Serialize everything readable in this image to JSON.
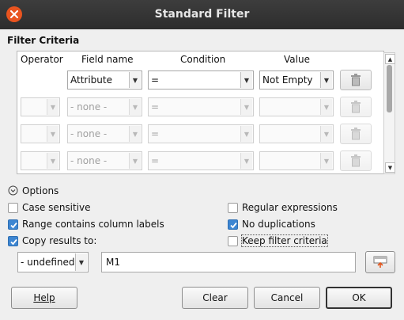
{
  "window": {
    "title": "Standard Filter"
  },
  "criteria": {
    "section_label": "Filter Criteria",
    "columns": {
      "operator": "Operator",
      "field": "Field name",
      "condition": "Condition",
      "value": "Value"
    },
    "rows": [
      {
        "operator": "",
        "field": "Attribute",
        "condition": "=",
        "value": "Not Empty",
        "enabled": true
      },
      {
        "operator": "",
        "field": "- none -",
        "condition": "=",
        "value": "",
        "enabled": false
      },
      {
        "operator": "",
        "field": "- none -",
        "condition": "=",
        "value": "",
        "enabled": false
      },
      {
        "operator": "",
        "field": "- none -",
        "condition": "=",
        "value": "",
        "enabled": false
      }
    ]
  },
  "options": {
    "expander_label": "Options",
    "case_sensitive": {
      "label": "Case sensitive",
      "checked": false
    },
    "range_labels": {
      "label": "Range contains column labels",
      "checked": true
    },
    "copy_results": {
      "label": "Copy results to:",
      "checked": true
    },
    "regex": {
      "label": "Regular expressions",
      "checked": false
    },
    "no_dup": {
      "label": "No duplications",
      "checked": true
    },
    "keep_filter": {
      "label": "Keep filter criteria",
      "checked": false
    },
    "copy_target_select": "- undefined -",
    "copy_target_value": "M1"
  },
  "buttons": {
    "help": "Help",
    "clear": "Clear",
    "cancel": "Cancel",
    "ok": "OK"
  },
  "colors": {
    "accent": "#3d86d2",
    "close": "#e9541f",
    "titlebar": "#2d2d2d"
  }
}
